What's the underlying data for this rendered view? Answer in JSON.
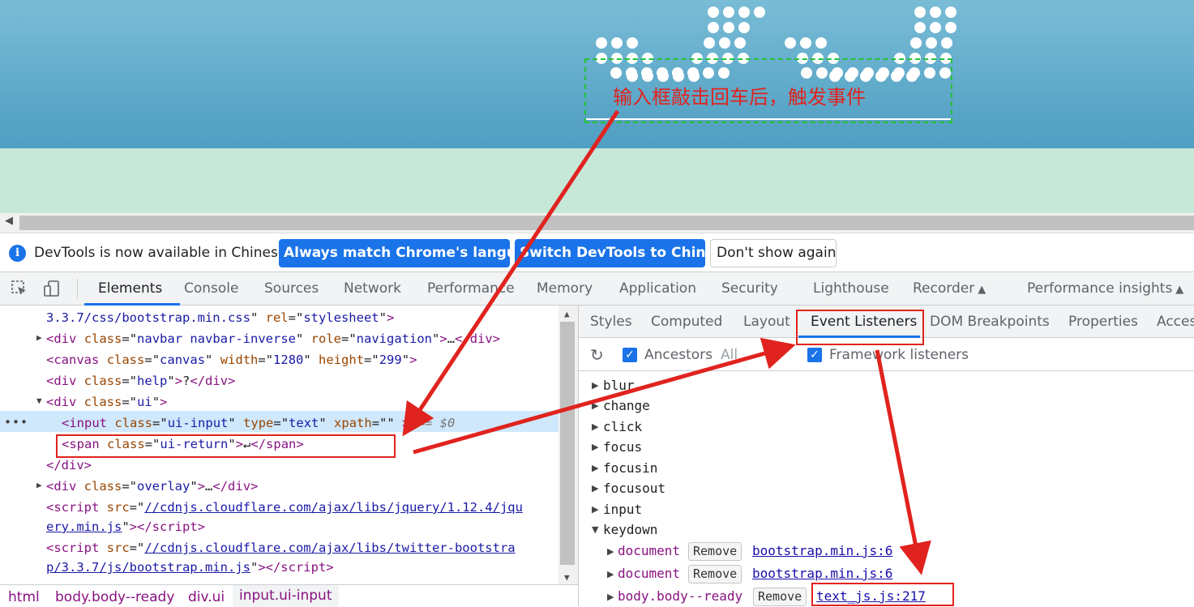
{
  "webpage": {
    "annotation": "输入框敲击回车后，触发事件",
    "colors": {
      "sky": "#4f9ec2",
      "ground": "#c6e8d9",
      "annotation": "#e0231e",
      "dashed_box": "#22c233"
    }
  },
  "banner": {
    "icon": "info-icon",
    "message": "DevTools is now available in Chinese!",
    "btn_match": "Always match Chrome's language",
    "btn_switch": "Switch DevTools to Chinese",
    "btn_dismiss": "Don't show again"
  },
  "tabs": {
    "elements": "Elements",
    "console": "Console",
    "sources": "Sources",
    "network": "Network",
    "performance": "Performance",
    "memory": "Memory",
    "application": "Application",
    "security": "Security",
    "lighthouse": "Lighthouse",
    "recorder": "Recorder",
    "perf_insights": "Performance insights"
  },
  "dom": {
    "l0_val": "3.3.7/css/bootstrap.min.css",
    "l0_attr": "rel",
    "l0_attrval": "stylesheet",
    "l1_tag": "div",
    "l1_cls": "navbar navbar-inverse",
    "l1_role": "navigation",
    "l2_tag": "canvas",
    "l2_cls": "canvas",
    "l2_w": "1280",
    "l2_h": "299",
    "l3_cls": "help",
    "l3_text": "?",
    "l4_cls": "ui",
    "l5_tag": "input",
    "l5_cls": "ui-input",
    "l5_type": "text",
    "l5_xpath": "xpath",
    "l5_eq": "== $0",
    "l6_tag": "span",
    "l6_cls": "ui-return",
    "l6_text": "↵",
    "l7_close": "</div>",
    "l8_cls": "overlay",
    "l9_src1": "//cdnjs.cloudflare.com/ajax/libs/jquery/1.12.4/jqu",
    "l10_src2": "ery.min.js",
    "l11_src1": "//cdnjs.cloudflare.com/ajax/libs/twitter-bootstra",
    "l12_src2": "p/3.3.7/js/bootstrap.min.js"
  },
  "breadcrumbs": [
    "html",
    "body.body--ready",
    "div.ui",
    "input.ui-input"
  ],
  "side_tabs": {
    "styles": "Styles",
    "computed": "Computed",
    "layout": "Layout",
    "event_listeners": "Event Listeners",
    "dom_breakpoints": "DOM Breakpoints",
    "properties": "Properties",
    "accessibility": "Acces"
  },
  "listener_toolbar": {
    "ancestors": "Ancestors",
    "all": "All",
    "framework": "Framework listeners"
  },
  "events": [
    "blur",
    "change",
    "click",
    "focus",
    "focusin",
    "focusout",
    "input",
    "keydown"
  ],
  "keydown_listeners": [
    {
      "node": "document",
      "remove": "Remove",
      "source": "bootstrap.min.js:6"
    },
    {
      "node": "document",
      "remove": "Remove",
      "source": "bootstrap.min.js:6"
    },
    {
      "node": "body.body--ready",
      "remove": "Remove",
      "source": "text_js.js:217"
    }
  ]
}
